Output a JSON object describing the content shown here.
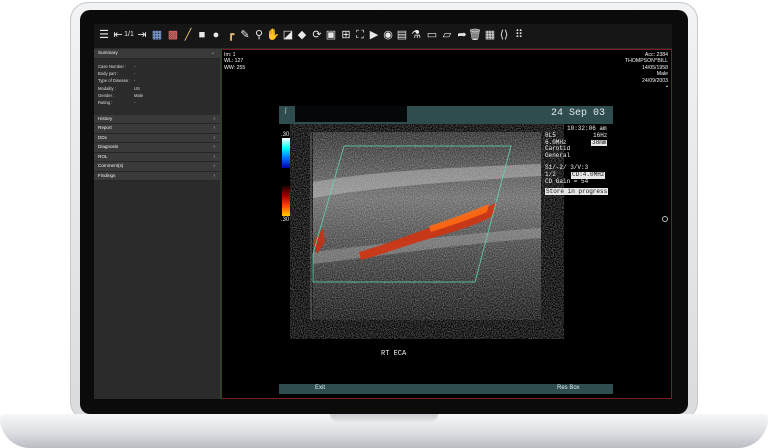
{
  "toolbar": {
    "icons": [
      "menu-icon",
      "step-back-icon",
      "series-1-1-icon",
      "step-forward-icon",
      "grid-layout-icon",
      "cross-layout-icon",
      "ruler-icon",
      "square-icon",
      "circle-icon",
      "angle-icon",
      "pencil-icon",
      "magnifier-icon",
      "hand-icon",
      "window-level-icon",
      "eraser-icon",
      "refresh-icon",
      "image-icon",
      "tile-icon",
      "fullscreen-icon",
      "play-icon",
      "record-icon",
      "stack-icon",
      "microscope-icon",
      "folder-icon",
      "comment-icon",
      "export-icon",
      "trash-icon",
      "calendar-icon",
      "share-icon",
      "apps-icon"
    ],
    "series_label": "1/1"
  },
  "sidebar": {
    "summary_label": "Summary",
    "fields": [
      {
        "label": "Case Number :",
        "value": "-"
      },
      {
        "label": "Body part :",
        "value": "-"
      },
      {
        "label": "Type of Disease :",
        "value": "-"
      },
      {
        "label": "Modality :",
        "value": "US"
      },
      {
        "label": "Gender :",
        "value": "Male"
      },
      {
        "label": "Rating :",
        "value": "-"
      }
    ],
    "sections": [
      "History",
      "Report",
      "DDx",
      "Diagnosis",
      "ROL",
      "Comment(s)",
      "Findings"
    ]
  },
  "overlay": {
    "left": [
      "Im: 1",
      "WL: 127",
      "WW: 255"
    ],
    "right": [
      "Acc: 2384",
      "THOMPSON^BILL",
      "14/05/1958",
      "Male",
      "24/09/2003"
    ]
  },
  "ultrasound": {
    "date": "24 Sep 03",
    "time": "10:32:06 am",
    "params": [
      {
        "left": "8L5",
        "right": "16Hz"
      },
      {
        "left": "6.0MHz",
        "right": "38mm",
        "right_boxed": true
      },
      {
        "left": "Carotid",
        "right": ""
      },
      {
        "left": "General",
        "right": ""
      }
    ],
    "doppler": [
      "S1/-2/ 3/V:3",
      "1/2",
      "CD Gain = 54"
    ],
    "doppler_box": "CD:4.0MHz",
    "status": "Store in progress",
    "scale_top": ".30",
    "scale_bottom": ".30",
    "view_label": "RT  ECA",
    "exit_label": "Exit",
    "resbox_label": "Res Box"
  }
}
